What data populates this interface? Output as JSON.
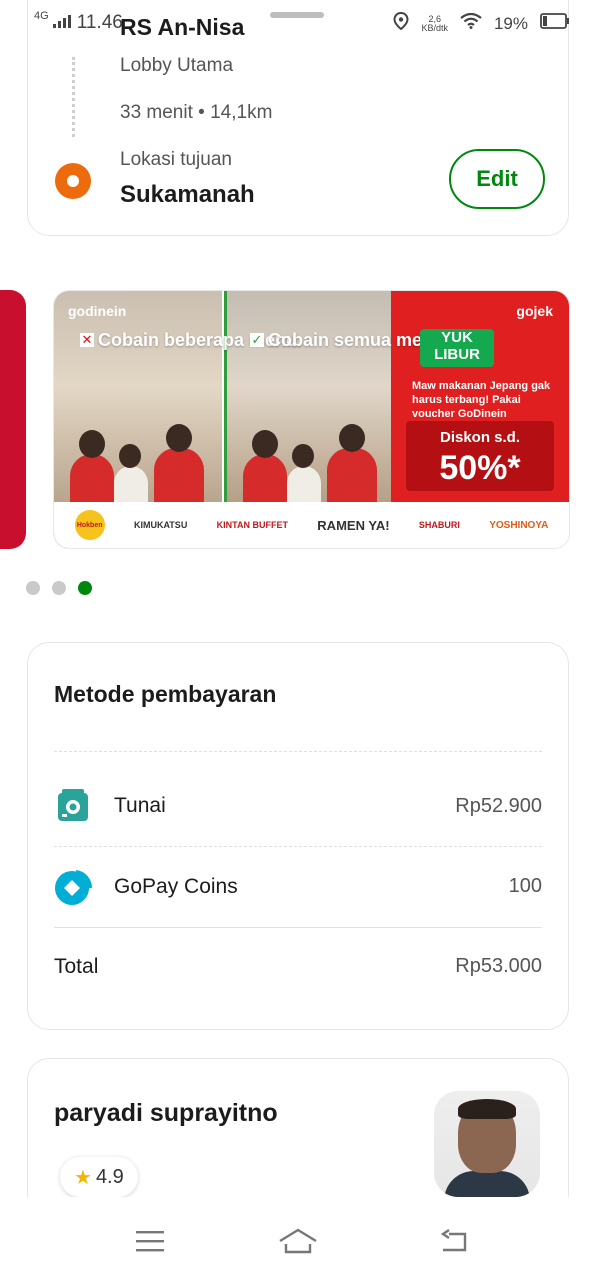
{
  "status_bar": {
    "network": "4G",
    "time": "11.46",
    "speed_value": "2,6",
    "speed_unit": "KB/dtk",
    "battery": "19%"
  },
  "route": {
    "origin_title": "RS An-Nisa",
    "origin_sub": "Lobby Utama",
    "meta": "33 menit • 14,1km",
    "destination_label": "Lokasi tujuan",
    "destination_value": "Sukamanah",
    "edit_label": "Edit"
  },
  "banner": {
    "brand": "godinein",
    "panel1_title": "Cobain beberapa menu.",
    "panel2_title": "Cobain semua menu.",
    "gojek": "gojek",
    "promo_headline": "YUK LIBUR",
    "promo_desc": "Maw makanan Jepang gak harus terbang! Pakai voucher GoDinein",
    "discount_label": "Diskon s.d.",
    "discount_value": "50%*",
    "partners": [
      "Hokben",
      "KIMUKATSU",
      "KINTAN BUFFET",
      "RAMEN YA!",
      "SHABURI",
      "YOSHINOYA"
    ]
  },
  "carousel": {
    "count": 3,
    "active_index": 2
  },
  "payment": {
    "title": "Metode pembayaran",
    "rows": [
      {
        "label": "Tunai",
        "amount": "Rp52.900",
        "icon": "cash-icon"
      },
      {
        "label": "GoPay Coins",
        "amount": "100",
        "icon": "gopay-coins-icon"
      }
    ],
    "total_label": "Total",
    "total_amount": "Rp53.000"
  },
  "driver": {
    "name": "paryadi suprayitno",
    "rating": "4.9"
  },
  "colors": {
    "accent": "#00880d",
    "destination": "#ee6b0d",
    "tunai": "#2aa39a",
    "gopay": "#00aed6",
    "star": "#f2b705"
  },
  "nav": {
    "menu": "menu-icon",
    "home": "home-icon",
    "back": "back-icon"
  }
}
